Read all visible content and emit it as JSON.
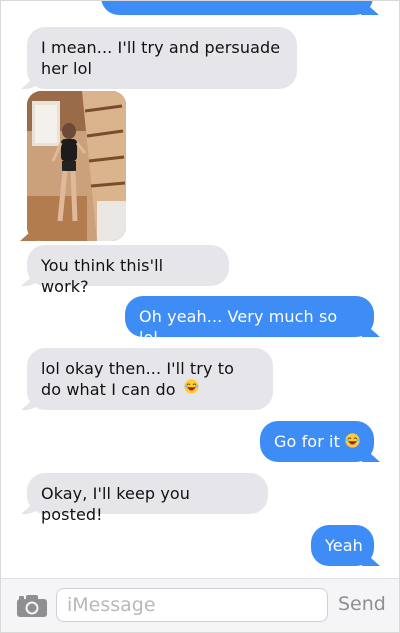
{
  "conversation": {
    "messages": [
      {
        "text": "I mean... I'll try and persuade her lol"
      },
      {
        "text": "You think this'll work?"
      },
      {
        "text": "Oh yeah... Very much so lol"
      },
      {
        "text": "lol okay then... I'll try to do what I can do"
      },
      {
        "text": "Go for it"
      },
      {
        "text": "Okay, I'll keep you posted!"
      },
      {
        "text": "Yeah"
      }
    ],
    "emoji": "laughing-emoji"
  },
  "colors": {
    "sent_bubble": "#3e8cf5",
    "received_bubble": "#e6e5ea",
    "send_label": "#8e8e93"
  },
  "input_bar": {
    "placeholder": "iMessage",
    "send_label": "Send",
    "camera_icon": "camera-icon"
  }
}
